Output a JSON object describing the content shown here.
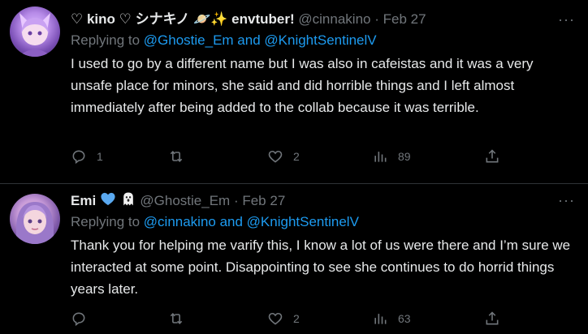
{
  "tweets": [
    {
      "display_name": "♡ kino ♡ シナキノ 🪐✨ envtuber!",
      "handle": "@cinnakino",
      "separator": "·",
      "date": "Feb 27",
      "reply_prefix": "Replying to ",
      "reply_mentions": "@Ghostie_Em and @KnightSentinelV",
      "text": "I used to go by a different name but I was also in cafeistas and it was a very unsafe place for minors, she said and did horrible things and I left almost immediately after being added to the collab because it was terrible.",
      "counts": {
        "replies": "1",
        "retweets": "",
        "likes": "2",
        "views": "89"
      },
      "more": "···"
    },
    {
      "display_name": "Emi",
      "name_emojis": [
        "blue-heart-icon",
        "ghost-icon"
      ],
      "handle": "@Ghostie_Em",
      "separator": "·",
      "date": "Feb 27",
      "reply_prefix": "Replying to ",
      "reply_mentions": "@cinnakino and @KnightSentinelV",
      "text": "Thank you for helping me varify this, I know a lot of us were there and I’m sure we interacted at some point. Disappointing to see she continues to do horrid things years later.",
      "counts": {
        "replies": "",
        "retweets": "",
        "likes": "2",
        "views": "63"
      },
      "more": "···"
    }
  ],
  "colors": {
    "background": "#000000",
    "text": "#e7e9ea",
    "muted": "#71767b",
    "link": "#1d9bf0",
    "divider": "#2f3336",
    "heart_blue": "#5aa9f0"
  }
}
